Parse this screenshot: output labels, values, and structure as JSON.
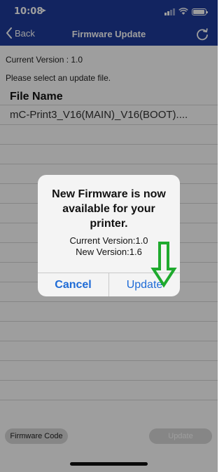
{
  "status": {
    "time": "10:08"
  },
  "nav": {
    "back_label": "Back",
    "title": "Firmware Update"
  },
  "info": {
    "current_version": "Current Version : 1.0",
    "prompt": "Please select an update file."
  },
  "file_list": {
    "header": "File Name",
    "rows": [
      "mC-Print3_V16(MAIN)_V16(BOOT)...."
    ]
  },
  "bottom": {
    "firmware_code_label": "Firmware Code",
    "update_label": "Update"
  },
  "alert": {
    "title": "New Firmware is now available for your printer.",
    "line1": "Current Version:1.0",
    "line2": "New Version:1.6",
    "cancel": "Cancel",
    "update": "Update"
  },
  "colors": {
    "brand": "#1d3a9b",
    "link": "#1e6bd6",
    "annotation": "#1faa2e"
  }
}
